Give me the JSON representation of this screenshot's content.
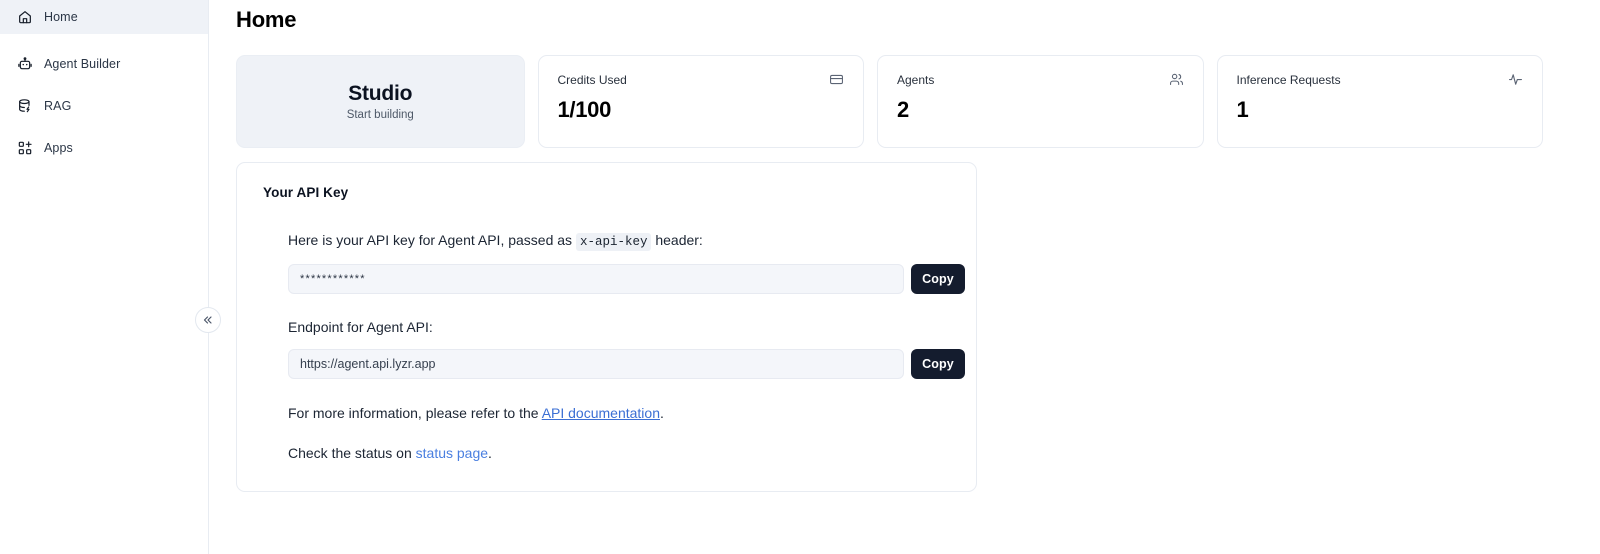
{
  "sidebar": {
    "items": [
      {
        "label": "Home",
        "icon": "home-icon",
        "active": true
      },
      {
        "label": "Agent Builder",
        "icon": "bot-icon",
        "active": false
      },
      {
        "label": "RAG",
        "icon": "database-icon",
        "active": false
      },
      {
        "label": "Apps",
        "icon": "grid-plus-icon",
        "active": false
      }
    ],
    "collapse_icon": "chevrons-left-icon"
  },
  "page": {
    "title": "Home"
  },
  "studio_card": {
    "title": "Studio",
    "subtitle": "Start building"
  },
  "stats": [
    {
      "label": "Credits Used",
      "value": "1/100",
      "icon": "credit-card-icon"
    },
    {
      "label": "Agents",
      "value": "2",
      "icon": "users-icon"
    },
    {
      "label": "Inference Requests",
      "value": "1",
      "icon": "activity-icon"
    }
  ],
  "api_panel": {
    "title": "Your API Key",
    "key_line_prefix": "Here is your API key for Agent API, passed as",
    "key_header_code": "x-api-key",
    "key_line_suffix": "header:",
    "api_key_masked": "************",
    "copy_label": "Copy",
    "endpoint_label": "Endpoint for Agent API:",
    "endpoint_value": "https://agent.api.lyzr.app",
    "endpoint_copy_label": "Copy",
    "info_prefix": "For more information, please refer to the",
    "info_link": "API documentation",
    "info_suffix": ".",
    "status_prefix": "Check the status on",
    "status_link": "status page",
    "status_suffix": "."
  },
  "colors": {
    "accent_dark": "#141c2e",
    "link": "#3b6fd4",
    "card_bg": "#eff2f7",
    "border": "#e8ecf2"
  }
}
